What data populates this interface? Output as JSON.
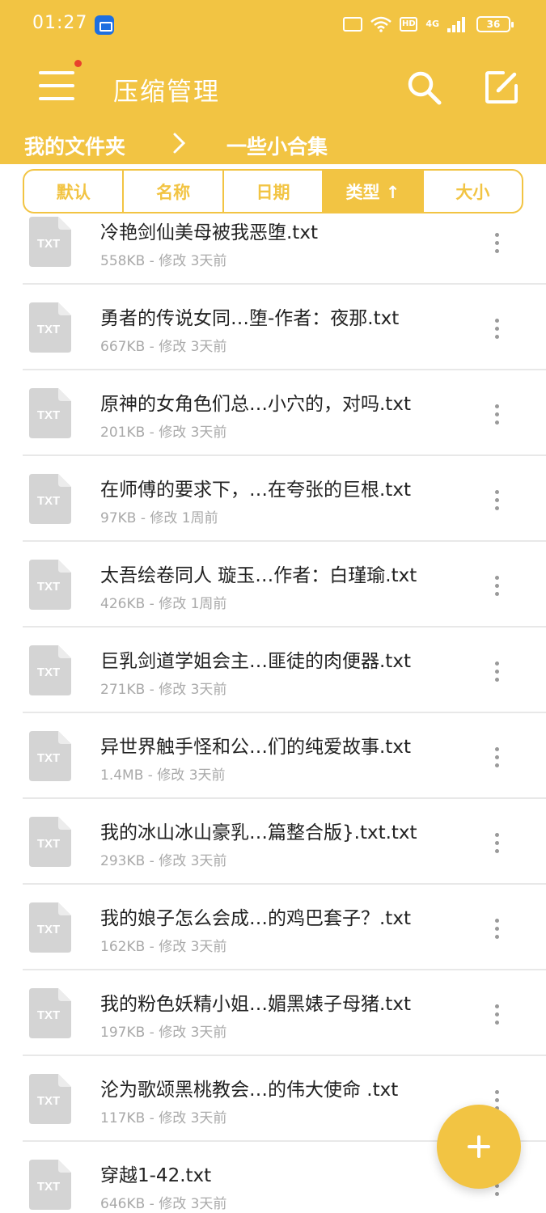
{
  "status_bar": {
    "time": "01:27",
    "hd_label": "HD",
    "network_label": "4G",
    "battery": "36"
  },
  "header": {
    "title": "压缩管理"
  },
  "breadcrumb": {
    "root": "我的文件夹",
    "current": "一些小合集"
  },
  "sort_tabs": [
    {
      "label": "默认",
      "active": false
    },
    {
      "label": "名称",
      "active": false
    },
    {
      "label": "日期",
      "active": false
    },
    {
      "label": "类型 ↑",
      "active": true
    },
    {
      "label": "大小",
      "active": false
    }
  ],
  "file_icon_label": "TXT",
  "files": [
    {
      "name": "冷艳剑仙美母被我恶堕.txt",
      "meta": "558KB - 修改 3天前"
    },
    {
      "name": "勇者的传说女同…堕-作者：夜那.txt",
      "meta": "667KB - 修改 3天前"
    },
    {
      "name": "原神的女角色们总…小穴的，对吗.txt",
      "meta": "201KB - 修改 3天前"
    },
    {
      "name": "在师傅的要求下，…在夸张的巨根.txt",
      "meta": "97KB - 修改 1周前"
    },
    {
      "name": "太吾绘卷同人 璇玉…作者：白瑾瑜.txt",
      "meta": "426KB - 修改 1周前"
    },
    {
      "name": "巨乳剑道学姐会主…匪徒的肉便器.txt",
      "meta": "271KB - 修改 3天前"
    },
    {
      "name": "异世界触手怪和公…们的纯爱故事.txt",
      "meta": "1.4MB - 修改 3天前"
    },
    {
      "name": "我的冰山冰山豪乳…篇整合版}.txt.txt",
      "meta": "293KB - 修改 3天前"
    },
    {
      "name": "我的娘子怎么会成…的鸡巴套子？.txt",
      "meta": "162KB - 修改 3天前"
    },
    {
      "name": "我的粉色妖精小姐…媚黑婊子母猪.txt",
      "meta": "197KB - 修改 3天前"
    },
    {
      "name": "沦为歌颂黑桃教会…的伟大使命  .txt",
      "meta": "117KB - 修改 3天前"
    },
    {
      "name": "穿越1-42.txt",
      "meta": "646KB - 修改 3天前"
    }
  ],
  "colors": {
    "accent": "#f2c443",
    "notification_dot": "#e8412c",
    "file_icon": "#d4d4d4",
    "meta_text": "#a9a9a9"
  },
  "icons": {
    "menu": "menu-icon",
    "search": "search-icon",
    "edit": "edit-icon",
    "more": "more-vert-icon",
    "add": "plus-icon"
  }
}
